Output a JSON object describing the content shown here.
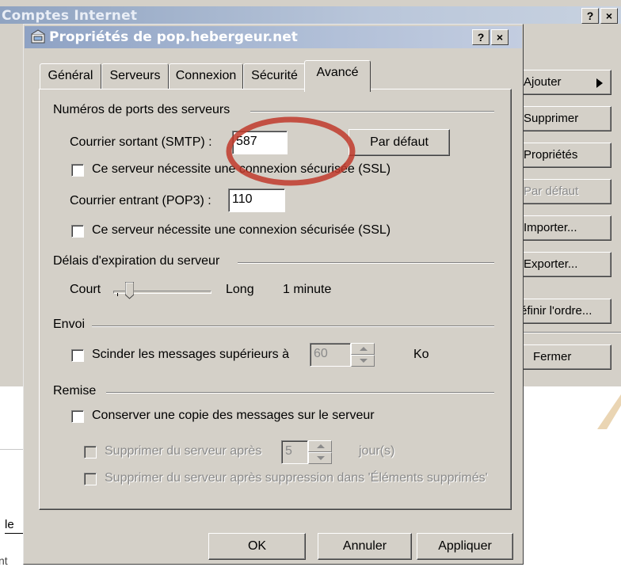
{
  "background_window": {
    "title": "Comptes Internet",
    "help_glyph": "?",
    "close_glyph": "×",
    "buttons": [
      {
        "label": "Ajouter",
        "disabled": false
      },
      {
        "label": "Supprimer",
        "disabled": false
      },
      {
        "label": "Propriétés",
        "disabled": false
      },
      {
        "label": "Par défaut",
        "disabled": true
      },
      {
        "label": "Importer...",
        "disabled": false
      },
      {
        "label": "Exporter...",
        "disabled": false
      },
      {
        "label": "éfinir l'ordre...",
        "disabled": false
      },
      {
        "label": "Fermer",
        "disabled": false
      }
    ],
    "left_fragment": "le",
    "bottom_fragment": "nt"
  },
  "dialog": {
    "title": "Propriétés de pop.hebergeur.net",
    "help_glyph": "?",
    "close_glyph": "×",
    "tabs": [
      {
        "label": "Général",
        "active": false
      },
      {
        "label": "Serveurs",
        "active": false
      },
      {
        "label": "Connexion",
        "active": false
      },
      {
        "label": "Sécurité",
        "active": false
      },
      {
        "label": "Avancé",
        "active": true
      }
    ],
    "ports": {
      "group_label": "Numéros de ports des serveurs",
      "smtp_label": "Courrier sortant (SMTP) :",
      "smtp_value": "587",
      "default_button": "Par défaut",
      "smtp_ssl_label": "Ce serveur nécessite une connexion sécurisée (SSL)",
      "smtp_ssl_checked": false,
      "pop3_label": "Courrier entrant (POP3) :",
      "pop3_value": "110",
      "pop3_ssl_label": "Ce serveur nécessite une connexion sécurisée (SSL)",
      "pop3_ssl_checked": false
    },
    "timeout": {
      "group_label": "Délais d'expiration du serveur",
      "short_label": "Court",
      "long_label": "Long",
      "value_text": "1 minute",
      "slider_fraction": 0.12
    },
    "send": {
      "group_label": "Envoi",
      "split_label": "Scinder les messages supérieurs à",
      "split_checked": false,
      "split_value": "60",
      "unit": "Ko"
    },
    "delivery": {
      "group_label": "Remise",
      "keep_copy_label": "Conserver une copie des messages sur le serveur",
      "keep_copy_checked": false,
      "delete_after_label": "Supprimer du serveur après",
      "delete_after_value": "5",
      "days_label": "jour(s)",
      "delete_on_removal_label": "Supprimer du serveur après suppression dans 'Éléments supprimés'"
    },
    "footer": {
      "ok": "OK",
      "cancel": "Annuler",
      "apply": "Appliquer"
    }
  },
  "annotation": {
    "color": "#c0392b",
    "shape": "ellipse highlighting SMTP port"
  }
}
